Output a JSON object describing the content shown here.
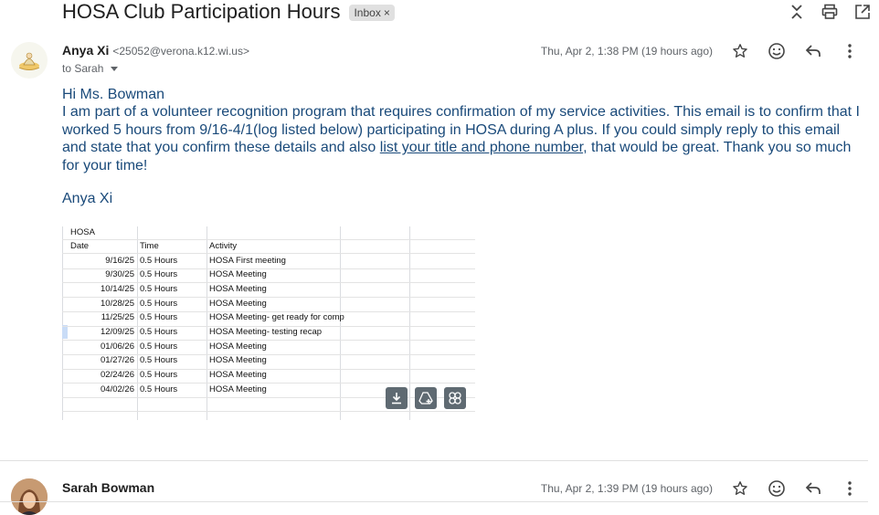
{
  "email": {
    "subject": "HOSA Club Participation Hours",
    "label": "Inbox",
    "label_remove": "×"
  },
  "message1": {
    "sender_name": "Anya Xi",
    "sender_email": "<25052@verona.k12.wi.us>",
    "to": "to Sarah",
    "date": "Thu, Apr 2, 1:38 PM (19 hours ago)",
    "greeting": "Hi Ms. Bowman",
    "para_before_link": "I am part of a volunteer recognition program that requires confirmation of my service activities. This email is to confirm that I worked 5 hours from 9/16-4/1(log listed below) participating in HOSA during A plus. If you could simply reply to this email and state that you confirm these details and also ",
    "para_link": "list your title and phone number",
    "para_after_link": ", that would be great. Thank you so much for your time!",
    "signature": "Anya Xi"
  },
  "attachment": {
    "sheet_title": "HOSA",
    "headers": [
      "Date",
      "Time",
      "Activity"
    ],
    "rows": [
      [
        "9/16/25",
        "0.5 Hours",
        "HOSA First meeting"
      ],
      [
        "9/30/25",
        "0.5 Hours",
        "HOSA Meeting"
      ],
      [
        "10/14/25",
        "0.5 Hours",
        "HOSA Meeting"
      ],
      [
        "10/28/25",
        "0.5 Hours",
        "HOSA Meeting"
      ],
      [
        "11/25/25",
        "0.5 Hours",
        "HOSA Meeting- get ready for comp"
      ],
      [
        "12/09/25",
        "0.5 Hours",
        "HOSA Meeting- testing recap"
      ],
      [
        "01/06/26",
        "0.5 Hours",
        "HOSA Meeting"
      ],
      [
        "01/27/26",
        "0.5 Hours",
        "HOSA Meeting"
      ],
      [
        "02/24/26",
        "0.5 Hours",
        "HOSA Meeting"
      ],
      [
        "04/02/26",
        "0.5 Hours",
        "HOSA Meeting"
      ]
    ],
    "actions": [
      "download-icon",
      "add-to-drive-icon",
      "save-to-photos-icon"
    ]
  },
  "message2": {
    "sender_name": "Sarah Bowman",
    "date": "Thu, Apr 2, 1:39 PM (19 hours ago)"
  },
  "icons": {
    "top": [
      "collapse-all-icon",
      "print-icon",
      "open-in-new-window-icon"
    ],
    "message_actions": [
      "star-icon",
      "emoji-reaction-icon",
      "reply-icon",
      "more-options-icon"
    ]
  },
  "colors": {
    "body_text": "#1a4a7a",
    "attachment_button": "#5f6a72"
  }
}
